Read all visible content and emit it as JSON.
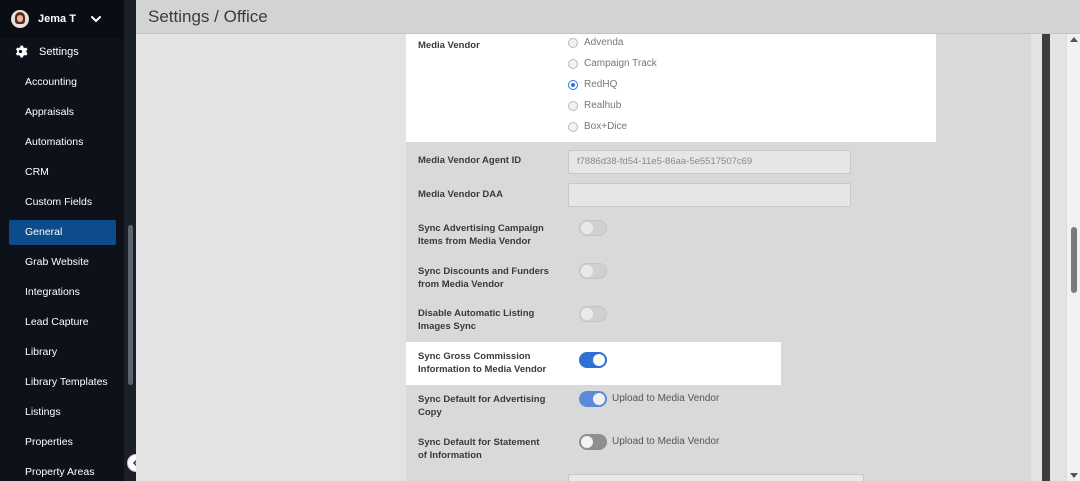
{
  "user": {
    "name": "Jema T"
  },
  "sidebar": {
    "settings_label": "Settings",
    "items": [
      {
        "label": "Accounting"
      },
      {
        "label": "Appraisals"
      },
      {
        "label": "Automations"
      },
      {
        "label": "CRM"
      },
      {
        "label": "Custom Fields"
      },
      {
        "label": "General"
      },
      {
        "label": "Grab Website"
      },
      {
        "label": "Integrations"
      },
      {
        "label": "Lead Capture"
      },
      {
        "label": "Library"
      },
      {
        "label": "Library Templates"
      },
      {
        "label": "Listings"
      },
      {
        "label": "Properties"
      },
      {
        "label": "Property Areas"
      }
    ],
    "active": "General"
  },
  "header": {
    "title": "Settings / Office"
  },
  "form": {
    "media_vendor": {
      "label": "Media Vendor",
      "options": [
        "Advenda",
        "Campaign Track",
        "RedHQ",
        "Realhub",
        "Box+Dice"
      ],
      "selected": "RedHQ"
    },
    "agent_id": {
      "label": "Media Vendor Agent ID",
      "value": "f7886d38-fd54-11e5-86aa-5e5517507c69"
    },
    "daa": {
      "label": "Media Vendor DAA",
      "value": ""
    },
    "sync_campaign": {
      "label_1": "Sync Advertising Campaign",
      "label_2": "Items from Media Vendor",
      "state": "off"
    },
    "sync_discounts": {
      "label_1": "Sync Discounts and Funders",
      "label_2": "from Media Vendor",
      "state": "off"
    },
    "disable_images": {
      "label_1": "Disable Automatic Listing",
      "label_2": "Images Sync",
      "state": "off"
    },
    "sync_gross": {
      "label_1": "Sync Gross Commission",
      "label_2": "Information to Media Vendor",
      "state": "on"
    },
    "sync_adcopy": {
      "label_1": "Sync Default for Advertising",
      "label_2": "Copy",
      "state": "on",
      "text": "Upload to Media Vendor"
    },
    "sync_statement": {
      "label_1": "Sync Default for Statement",
      "label_2": "of Information",
      "state": "off",
      "text": "Upload to Media Vendor"
    }
  },
  "colors": {
    "accent": "#2f6fd6",
    "sidebar_bg": "#0d111a",
    "active_nav": "#0e4b8a"
  }
}
